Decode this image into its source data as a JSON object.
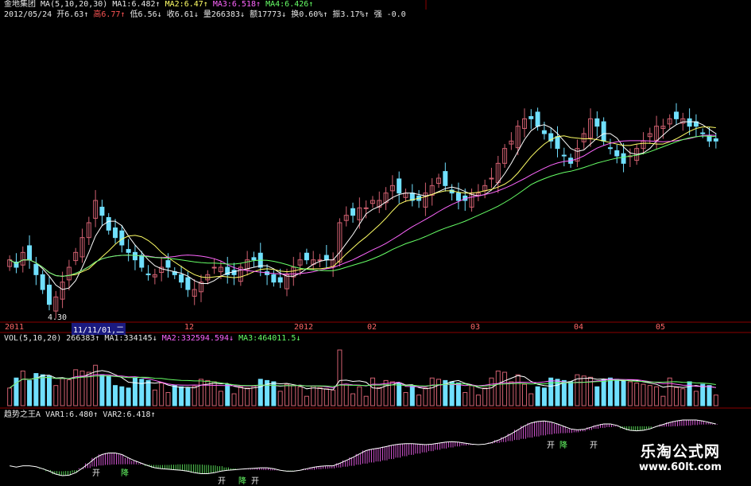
{
  "header": {
    "stock_name": "金地集团",
    "ma_label": "MA(5,10,20,30)",
    "ma1": "MA1:6.482",
    "ma2": "MA2:6.47",
    "ma3": "MA3:6.518",
    "ma4": "MA4:6.426",
    "date": "2012/05/24",
    "open": "开6.63",
    "high": "高6.77",
    "low": "低6.56",
    "close": "收6.61",
    "volume": "量266383",
    "amount": "额17773",
    "turnover": "换0.60%",
    "amplitude": "振3.17%",
    "strength": "强 -0.0"
  },
  "vol_header": {
    "label": "VOL(5,10,20)",
    "value": "266383",
    "ma1": "MA1:334145",
    "ma2": "MA2:332594.594",
    "ma3": "MA3:464011.5"
  },
  "ind_header": {
    "label": "趋势之王A",
    "var1": "VAR1:6.480",
    "var2": "VAR2:6.418"
  },
  "annotations": {
    "low_price": "4.30",
    "cursor_date": "11/11/01,二"
  },
  "x_axis": [
    "2011",
    "12",
    "2012",
    "02",
    "03",
    "04",
    "05"
  ],
  "signals": [
    "开",
    "降"
  ],
  "watermark": {
    "title": "乐淘公式网",
    "url": "www.60lt.com"
  },
  "colors": {
    "background": "#000000",
    "up_candle": "#d06070",
    "down_candle": "#70e0ff",
    "ma1": "#ffffff",
    "ma2": "#ffff66",
    "ma3": "#ff66ff",
    "ma4": "#66ff66",
    "grid": "#8b0000"
  },
  "chart_data": {
    "type": "candlestick",
    "title": "金地集团",
    "y_range": [
      4.3,
      7.0
    ],
    "period": [
      "2011-10",
      "2012-05-24"
    ],
    "price_low": 4.3,
    "last_bar": {
      "date": "2012/05/24",
      "open": 6.63,
      "high": 6.77,
      "low": 6.56,
      "close": 6.61,
      "volume": 266383
    },
    "moving_averages": {
      "MA1": 6.482,
      "MA2": 6.47,
      "MA3": 6.518,
      "MA4": 6.426
    },
    "volume_averages": {
      "MA1": 334145,
      "MA2": 332594.594,
      "MA3": 464011.5
    },
    "indicator": {
      "name": "趋势之王A",
      "VAR1": 6.48,
      "VAR2": 6.418
    },
    "close_series": [
      5.0,
      4.9,
      5.1,
      5.0,
      4.8,
      4.6,
      4.4,
      4.5,
      4.7,
      4.9,
      5.1,
      5.3,
      5.5,
      5.8,
      5.6,
      5.4,
      5.3,
      5.2,
      5.1,
      5.0,
      4.9,
      4.8,
      4.8,
      4.9,
      4.9,
      4.8,
      4.7,
      4.6,
      4.6,
      4.7,
      4.8,
      4.9,
      4.9,
      4.8,
      4.8,
      4.9,
      5.0,
      5.0,
      4.9,
      4.8,
      4.7,
      4.7,
      4.8,
      4.9,
      5.0,
      5.0,
      5.0,
      5.0,
      5.0,
      5.0,
      5.5,
      5.6,
      5.6,
      5.7,
      5.7,
      5.8,
      5.8,
      5.9,
      6.0,
      5.9,
      5.9,
      5.8,
      5.8,
      5.9,
      6.0,
      6.1,
      6.0,
      5.9,
      5.8,
      5.8,
      5.9,
      5.9,
      6.0,
      6.1,
      6.3,
      6.5,
      6.6,
      6.8,
      6.9,
      6.9,
      6.8,
      6.7,
      6.6,
      6.5,
      6.4,
      6.3,
      6.5,
      6.7,
      6.9,
      6.8,
      6.6,
      6.5,
      6.4,
      6.3,
      6.4,
      6.5,
      6.6,
      6.7,
      6.8,
      6.8,
      6.9,
      6.9,
      6.9,
      6.8,
      6.8,
      6.7,
      6.6,
      6.6
    ]
  }
}
